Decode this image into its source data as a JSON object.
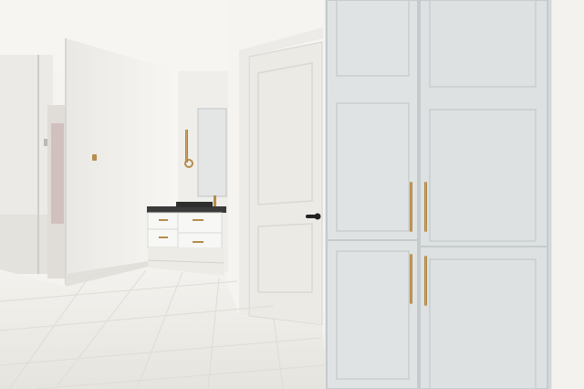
{
  "scene": {
    "kind": "photo-interior-bathroom-hallway"
  },
  "objects": [
    {
      "name": "tiled-floor"
    },
    {
      "name": "glass-shower-enclosure"
    },
    {
      "name": "vanity-cabinet"
    },
    {
      "name": "vanity-mirror"
    },
    {
      "name": "brass-towel-ring"
    },
    {
      "name": "interior-door"
    },
    {
      "name": "door-handle"
    },
    {
      "name": "linen-cabinet"
    }
  ],
  "colors": {
    "wall": "#f4f3f0",
    "cabinet": "#d9dee0",
    "cabinet_shadow": "#c6ccce",
    "door": "#ecebe7",
    "floor": "#eceae4",
    "brass": "#b68d4a",
    "counter": "#3b3b3b"
  }
}
